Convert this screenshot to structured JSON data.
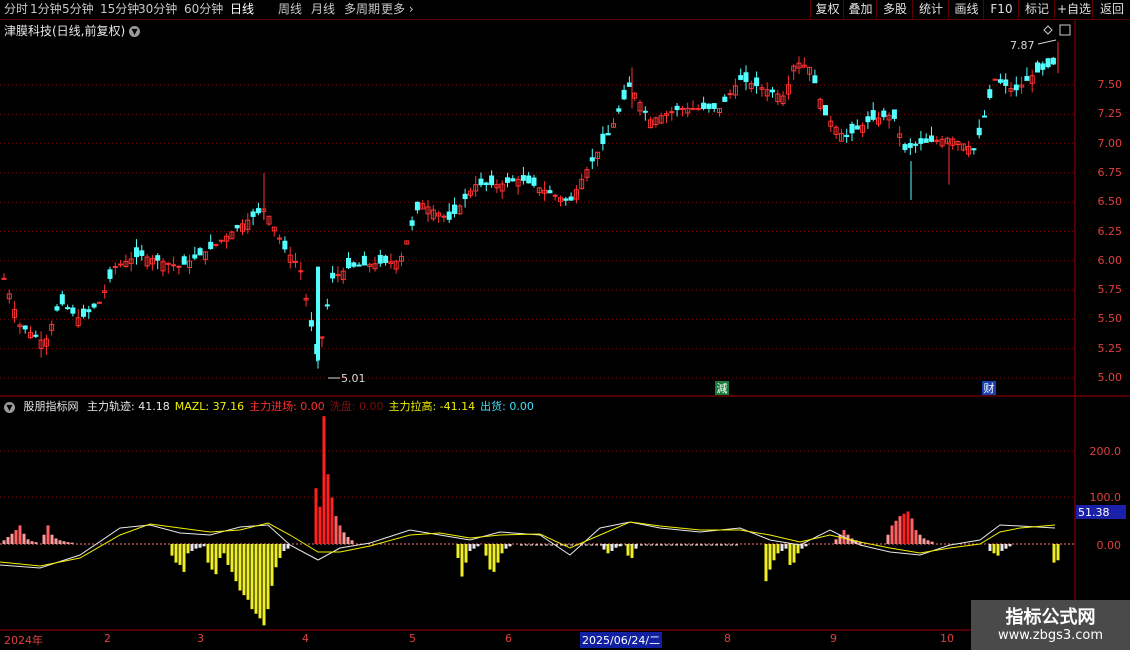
{
  "periods": [
    "分时",
    "1分钟",
    "5分钟",
    "15分钟",
    "30分钟",
    "60分钟",
    "日线",
    "周线",
    "月线",
    "多周期",
    "更多"
  ],
  "active_period": "日线",
  "toolbar": [
    "复权",
    "叠加",
    "多股",
    "统计",
    "画线",
    "F10",
    "标记",
    "+自选",
    "返回"
  ],
  "stock": {
    "title": "津膜科技(日线,前复权)"
  },
  "price_axis": [
    "7.50",
    "7.25",
    "7.00",
    "6.75",
    "6.50",
    "6.25",
    "6.00",
    "5.75",
    "5.50",
    "5.25",
    "5.00"
  ],
  "annotations": {
    "high": "7.87",
    "low": "5.01",
    "jian": "減",
    "cai": "财"
  },
  "indicator": {
    "name": "股朋指标网",
    "values": [
      {
        "label": "主力轨迹:",
        "value": "41.18",
        "color": "#e8e8e8"
      },
      {
        "label": "MAZL:",
        "value": "37.16",
        "color": "#f0f000"
      },
      {
        "label": "主力进场:",
        "value": "0.00",
        "color": "#ff3030"
      },
      {
        "label": "洗盘:",
        "value": "0.00",
        "color": "#7a1010"
      },
      {
        "label": "主力拉高:",
        "value": "-41.14",
        "color": "#f0f000"
      },
      {
        "label": "出货:",
        "value": "0.00",
        "color": "#40e0ff"
      }
    ],
    "axis": [
      "200.0",
      "100.0",
      "0.00"
    ],
    "current": "51.38"
  },
  "x_axis": {
    "year": "2024年",
    "months": [
      "2",
      "3",
      "4",
      "5",
      "6",
      "8",
      "9",
      "10"
    ],
    "cursor_date": "2025/06/24/二"
  },
  "watermark": {
    "line1": "指标公式网",
    "line2": "www.zbgs3.com"
  },
  "colors": {
    "up": "#ff3232",
    "down": "#54ffff",
    "grid": "#8b0000"
  }
}
